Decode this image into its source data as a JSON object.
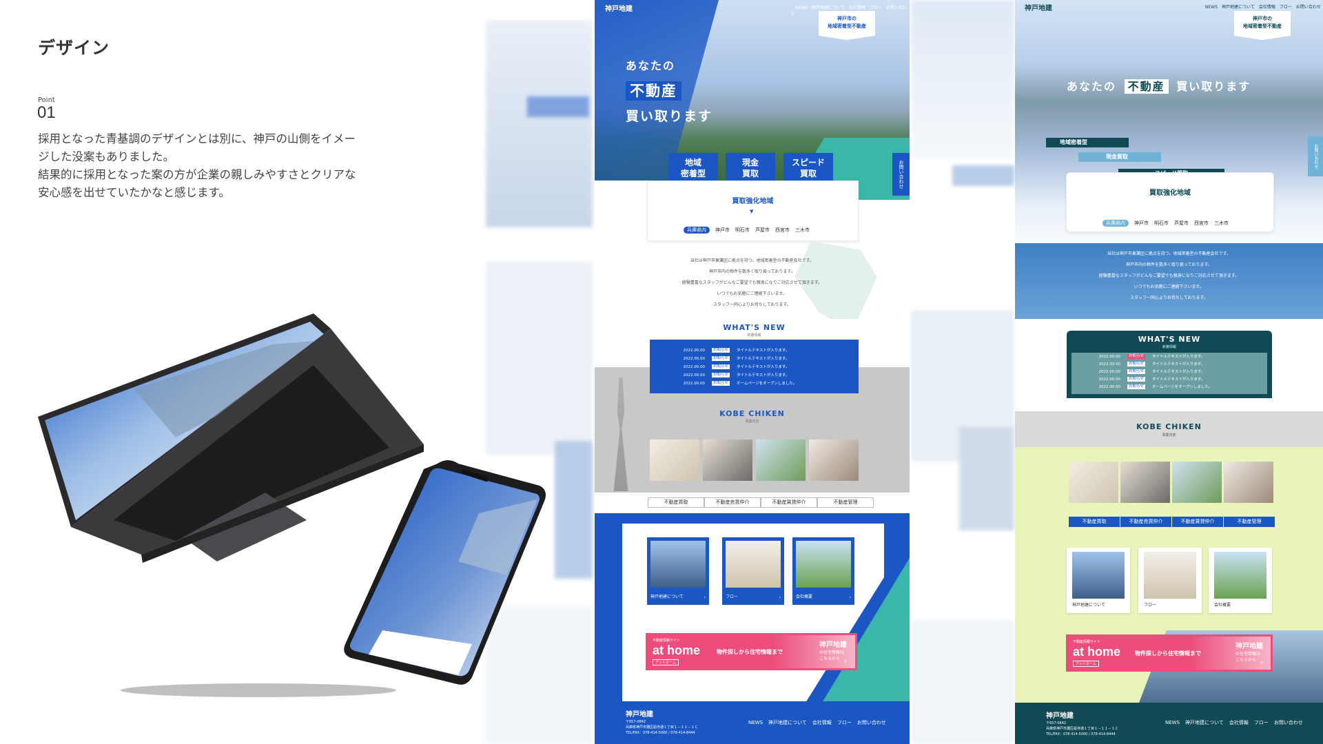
{
  "header": {
    "title": "デザイン",
    "point_label": "Point",
    "point_number": "01"
  },
  "description": {
    "lines": [
      "採用となった青基調のデザインとは別に、神戸の山側をイメー",
      "ジした没案もありました。",
      "結果的に採用となった案の方が企業の親しみやすさとクリアな",
      "安心感を出せていたかなと感じます。"
    ]
  },
  "site": {
    "logo": "神戸地建",
    "nav": [
      "NEWS",
      "神戸地建について",
      "会社情報",
      "フロー",
      "お問い合わせ"
    ],
    "badge": {
      "line1": "神戸市の",
      "line2": "地域密着型不動産"
    },
    "hero": {
      "line1": "あなたの",
      "line2": "不動産",
      "line3": "買い取ります"
    },
    "features": [
      "地域\n密着型",
      "現金\n買取",
      "スピード\n買取"
    ],
    "features_alt": [
      "地域密着型",
      "現金買取",
      "スピード買取"
    ],
    "area": {
      "title": "買取強化地域",
      "chips": [
        "兵庫県内",
        "神戸市",
        "明石市",
        "芦屋市",
        "西宮市",
        "三木市"
      ]
    },
    "side_tab": "お問い合わせ",
    "intro": [
      "当社は神戸市東灘区に拠点を持つ、地域密着型の不動産会社です。",
      "神戸市内の物件を数多く取り扱っております。",
      "経験豊富なスタッフがどんなご要望でも親身になりご対応させて頂きます。",
      "いつでもお気軽にご連絡下さいませ。",
      "スタッフ一同心よりお待ちしております。"
    ],
    "news": {
      "title": "WHAT'S NEW",
      "subtitle": "新着情報",
      "rows": [
        {
          "date": "2022.00.00",
          "tag": "お知らせ",
          "text": "タイトルテキストが入ります。"
        },
        {
          "date": "2022.00.00",
          "tag": "お知らせ",
          "text": "タイトルテキストが入ります。"
        },
        {
          "date": "2022.00.00",
          "tag": "お知らせ",
          "text": "タイトルテキストが入ります。"
        },
        {
          "date": "2022.00.00",
          "tag": "お知らせ",
          "text": "タイトルテキストが入ります。"
        },
        {
          "date": "2022.00.00",
          "tag": "お知らせ",
          "text": "ホームページをオープンしました。"
        }
      ]
    },
    "services": {
      "title": "KOBE CHIKEN",
      "subtitle": "事業内容",
      "buttons": [
        "不動産買取",
        "不動産売買仲介",
        "不動産賃貸仲介",
        "不動産管理"
      ]
    },
    "cards": [
      "神戸地建について",
      "フロー",
      "会社概要"
    ],
    "banner": {
      "small": "不動産情報サイト",
      "brand": "at home",
      "tag": "アットホーム",
      "copy": "物件探しから住宅情報まで",
      "right_title": "神戸地建",
      "right_sub": "の住宅情報は\nこちらから"
    },
    "footer": {
      "logo": "神戸地建",
      "address1": "〒657-0842",
      "address2": "兵庫県神戸市灘区船寺通１丁目１－１１－１Ｃ",
      "tel": "TEL/FAX：078-414-5000 / 078-414-8444"
    }
  },
  "colors": {
    "primary": "#1a57c4",
    "teal": "#3bb7a9",
    "pink": "#ec4d7b",
    "dark_teal": "#0f4a55",
    "light_green": "#e8f4b8"
  }
}
